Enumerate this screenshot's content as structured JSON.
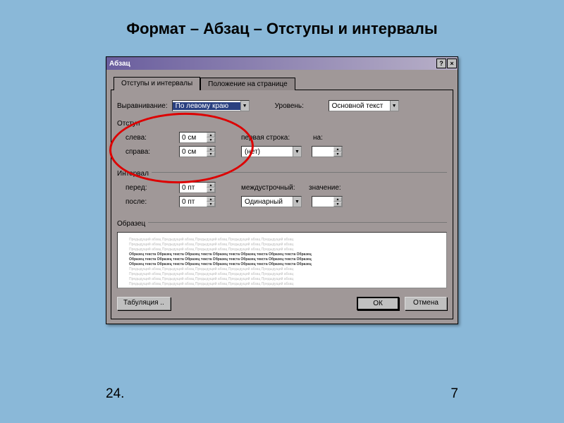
{
  "slide": {
    "title": "Формат – Абзац – Отступы и интервалы",
    "footer_left": "24.",
    "footer_right": "7"
  },
  "dialog": {
    "title": "Абзац",
    "help_icon": "?",
    "close_icon": "×",
    "tabs": {
      "active": "Отступы и интервалы",
      "inactive": "Положение на странице"
    },
    "alignment": {
      "label": "Выравнивание:",
      "value": "По левому краю"
    },
    "level": {
      "label": "Уровень:",
      "value": "Основной текст"
    },
    "indent_group": "Отступ",
    "indent_left": {
      "label": "слева:",
      "value": "0 см"
    },
    "indent_right": {
      "label": "справа:",
      "value": "0 см"
    },
    "first_line": {
      "label": "первая строка:",
      "value": "(нет)"
    },
    "by1": {
      "label": "на:",
      "value": ""
    },
    "spacing_group": "Интервал",
    "before": {
      "label": "перед:",
      "value": "0 пт"
    },
    "after": {
      "label": "после:",
      "value": "0 пт"
    },
    "line_spacing": {
      "label": "междустрочный:",
      "value": "Одинарный"
    },
    "by2": {
      "label": "значение:",
      "value": ""
    },
    "preview_label": "Образец",
    "preview_gray": "Предыдущий абзац Предыдущий абзац Предыдущий абзац Предыдущий абзац Предыдущий абзац",
    "preview_dark": "Образец текста Образец текста Образец текста Образец текста Образец текста Образец текста Образец",
    "buttons": {
      "tab": "Табуляция ..",
      "ok": "ОК",
      "cancel": "Отмена"
    }
  }
}
